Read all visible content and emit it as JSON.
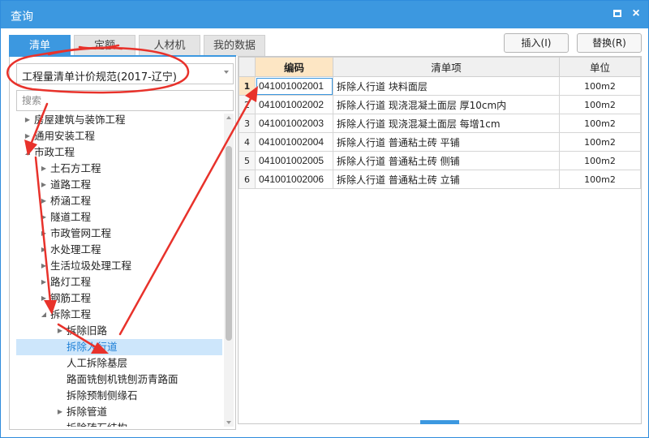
{
  "window": {
    "title": "查询",
    "maximize_glyph": "maximize-icon",
    "close_glyph": "×"
  },
  "tabs": [
    {
      "label": "清单",
      "active": true
    },
    {
      "label": "定额",
      "active": false
    },
    {
      "label": "人材机",
      "active": false
    },
    {
      "label": "我的数据",
      "active": false
    }
  ],
  "actions": {
    "insert_label": "插入(I)",
    "replace_label": "替换(R)"
  },
  "left": {
    "spec_dropdown": "工程量清单计价规范(2017-辽宁)",
    "search_placeholder": "搜索",
    "tree": [
      {
        "label": "房屋建筑与装饰工程",
        "depth": 0,
        "expander": "collapsed"
      },
      {
        "label": "通用安装工程",
        "depth": 0,
        "expander": "collapsed"
      },
      {
        "label": "市政工程",
        "depth": 0,
        "expander": "expanded"
      },
      {
        "label": "土石方工程",
        "depth": 1,
        "expander": "collapsed"
      },
      {
        "label": "道路工程",
        "depth": 1,
        "expander": "collapsed"
      },
      {
        "label": "桥涵工程",
        "depth": 1,
        "expander": "collapsed"
      },
      {
        "label": "隧道工程",
        "depth": 1,
        "expander": "collapsed"
      },
      {
        "label": "市政管网工程",
        "depth": 1,
        "expander": "collapsed"
      },
      {
        "label": "水处理工程",
        "depth": 1,
        "expander": "collapsed"
      },
      {
        "label": "生活垃圾处理工程",
        "depth": 1,
        "expander": "collapsed"
      },
      {
        "label": "路灯工程",
        "depth": 1,
        "expander": "collapsed"
      },
      {
        "label": "钢筋工程",
        "depth": 1,
        "expander": "collapsed"
      },
      {
        "label": "拆除工程",
        "depth": 1,
        "expander": "expanded"
      },
      {
        "label": "拆除旧路",
        "depth": 2,
        "expander": "collapsed"
      },
      {
        "label": "拆除人行道",
        "depth": 2,
        "expander": "none",
        "selected": true
      },
      {
        "label": "人工拆除基层",
        "depth": 2,
        "expander": "none"
      },
      {
        "label": "路面铣刨机铣刨沥青路面",
        "depth": 2,
        "expander": "none"
      },
      {
        "label": "拆除预制侧缘石",
        "depth": 2,
        "expander": "none"
      },
      {
        "label": "拆除管道",
        "depth": 2,
        "expander": "collapsed"
      },
      {
        "label": "拆除砖石结构",
        "depth": 2,
        "expander": "none"
      }
    ]
  },
  "grid": {
    "headers": {
      "code": "编码",
      "item": "清单项",
      "unit": "单位"
    },
    "rows": [
      {
        "n": "1",
        "code": "041001002001",
        "item": "拆除人行道 块料面层",
        "unit": "100m2"
      },
      {
        "n": "2",
        "code": "041001002002",
        "item": "拆除人行道 现浇混凝土面层 厚10cm内",
        "unit": "100m2"
      },
      {
        "n": "3",
        "code": "041001002003",
        "item": "拆除人行道 现浇混凝土面层 每增1cm",
        "unit": "100m2"
      },
      {
        "n": "4",
        "code": "041001002004",
        "item": "拆除人行道 普通粘土砖 平铺",
        "unit": "100m2"
      },
      {
        "n": "5",
        "code": "041001002005",
        "item": "拆除人行道 普通粘土砖 侧铺",
        "unit": "100m2"
      },
      {
        "n": "6",
        "code": "041001002006",
        "item": "拆除人行道 普通粘土砖 立铺",
        "unit": "100m2"
      }
    ]
  },
  "colors": {
    "accent": "#3c98e0",
    "header_highlight": "#fde6c4",
    "selection": "#cde6fb",
    "annotation": "#e8322b"
  }
}
